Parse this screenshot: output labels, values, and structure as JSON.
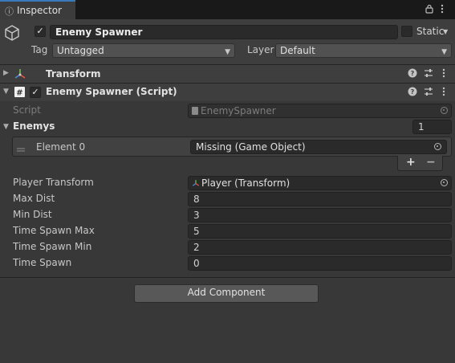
{
  "tab": {
    "title": "Inspector",
    "icon": "info-icon"
  },
  "tab_actions": {
    "lock_icon": "lock-icon",
    "menu_icon": "kebab-menu-icon"
  },
  "game_object": {
    "icon": "cube-icon",
    "active": true,
    "name": "Enemy Spawner",
    "static_label": "Static",
    "static_checked": false,
    "tag_label": "Tag",
    "tag_value": "Untagged",
    "layer_label": "Layer",
    "layer_value": "Default"
  },
  "components": {
    "transform": {
      "name": "Transform",
      "expanded": false
    },
    "script": {
      "name": "Enemy Spawner (Script)",
      "enabled": true,
      "expanded": true,
      "script_label": "Script",
      "script_value": "EnemySpawner",
      "enemys": {
        "label": "Enemys",
        "size": "1",
        "elements": [
          {
            "label": "Element 0",
            "value": "Missing (Game Object)"
          }
        ],
        "add_icon": "+",
        "remove_icon": "−"
      },
      "fields": [
        {
          "label": "Player Transform",
          "value": "Player (Transform)",
          "type": "object"
        },
        {
          "label": "Max Dist",
          "value": "8"
        },
        {
          "label": "Min Dist",
          "value": "3"
        },
        {
          "label": "Time Spawn Max",
          "value": "5"
        },
        {
          "label": "Time Spawn Min",
          "value": "2"
        },
        {
          "label": "Time Spawn",
          "value": "0"
        }
      ]
    }
  },
  "add_component_label": "Add Component",
  "colors": {
    "accent": "#3a79bb",
    "background": "#383838",
    "header": "#3e3e3e",
    "field": "#2a2a2a"
  }
}
